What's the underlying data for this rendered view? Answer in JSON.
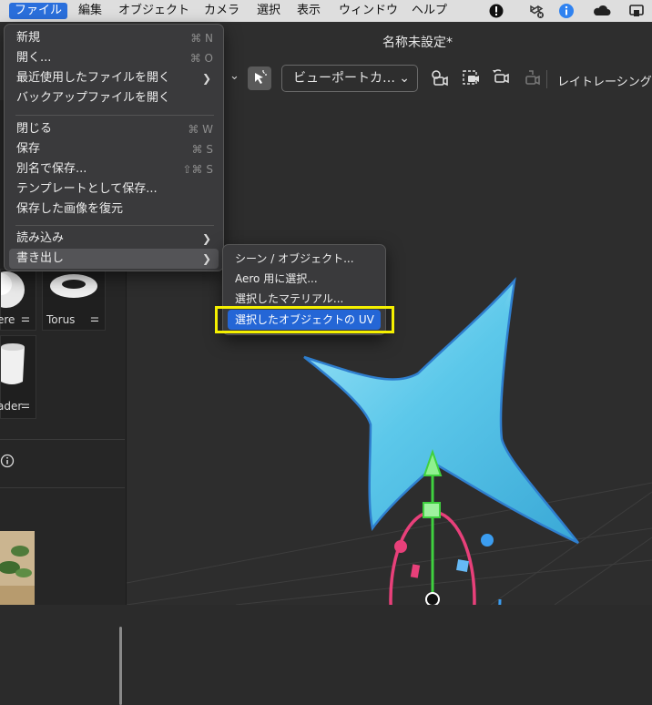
{
  "menubar": {
    "items": [
      "ファイル",
      "編集",
      "オブジェクト",
      "カメラ",
      "選択",
      "表示",
      "ウィンドウ",
      "ヘルプ"
    ],
    "active_index": 0,
    "status_icons": [
      "alert-icon",
      "dropbox-icon",
      "info-icon",
      "cloud-icon",
      "screen-share-icon"
    ]
  },
  "window": {
    "title": "名称未設定*"
  },
  "toolbar": {
    "viewport_camera_label": "ビューポートカ…",
    "raytracing_label": "レイトレーシング"
  },
  "left_panel": {
    "assets": [
      {
        "label": "ere"
      },
      {
        "label": "Torus"
      },
      {
        "label": "ader"
      }
    ],
    "info_icon": "info-icon"
  },
  "file_menu": {
    "items": [
      {
        "label": "新規",
        "shortcut": "⌘ N"
      },
      {
        "label": "開く...",
        "shortcut": "⌘ O"
      },
      {
        "label": "最近使用したファイルを開く",
        "submenu": true
      },
      {
        "label": "バックアップファイルを開く"
      },
      {
        "label": "閉じる",
        "shortcut": "⌘ W"
      },
      {
        "label": "保存",
        "shortcut": "⌘ S"
      },
      {
        "label": "別名で保存...",
        "shortcut": "⇧⌘ S"
      },
      {
        "label": "テンプレートとして保存..."
      },
      {
        "label": "保存した画像を復元"
      },
      {
        "label": "読み込み",
        "submenu": true
      },
      {
        "label": "書き出し",
        "submenu": true,
        "highlighted": true
      }
    ]
  },
  "export_menu": {
    "items": [
      {
        "label": "シーン / オブジェクト..."
      },
      {
        "label": "Aero 用に選択..."
      },
      {
        "label": "選択したマテリアル..."
      },
      {
        "label": "選択したオブジェクトの UV",
        "selected": true
      }
    ]
  },
  "colors": {
    "menu_selection": "#2466d6",
    "callout": "#f5f000",
    "star_fill": "#5cc8ea",
    "star_edge": "#2f7fcf",
    "gizmo_y": "#3fd13f",
    "gizmo_x": "#e8407a",
    "gizmo_z": "#3b9df0"
  }
}
